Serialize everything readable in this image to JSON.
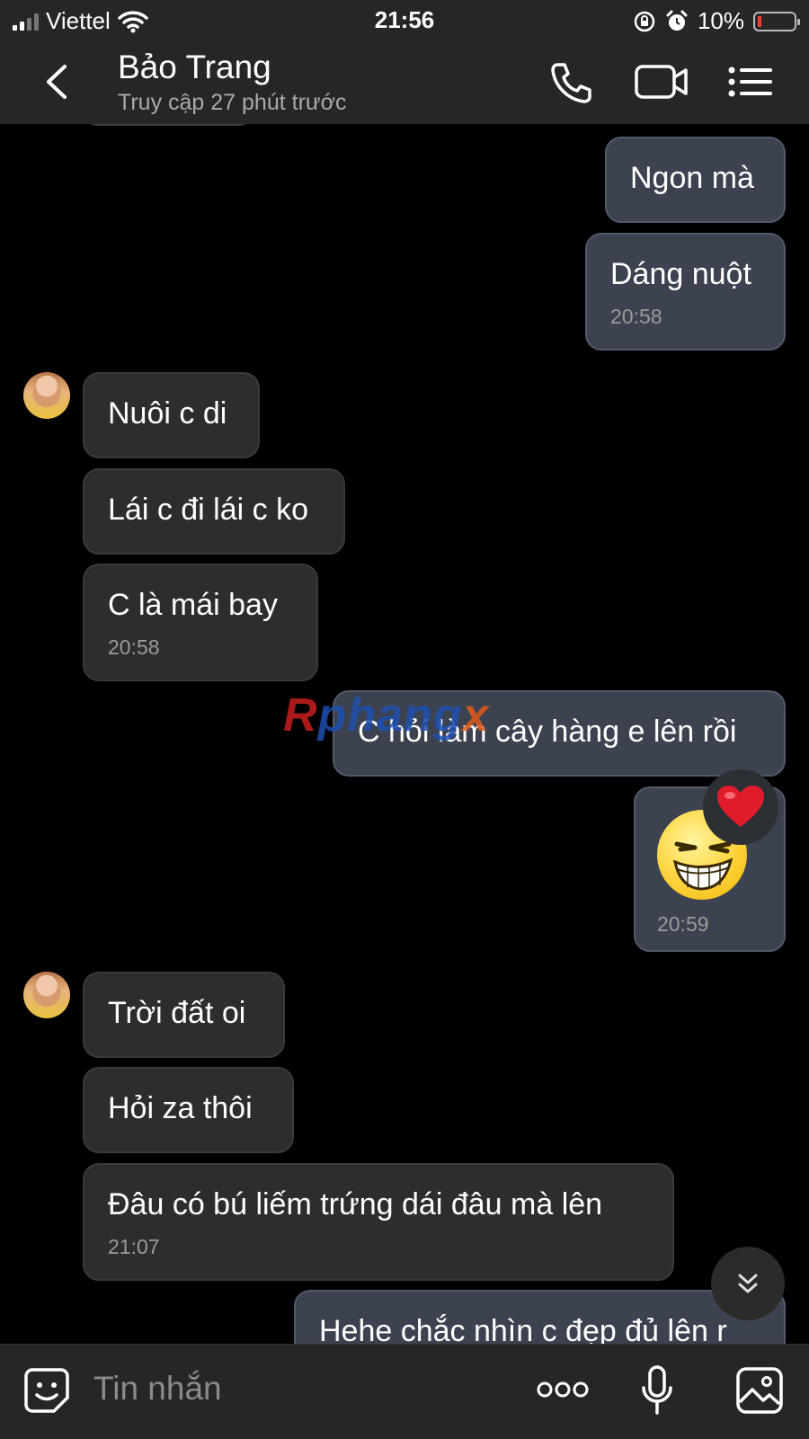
{
  "status_bar": {
    "carrier": "Viettel",
    "time": "21:56",
    "battery_percent": "10%"
  },
  "header": {
    "contact_name": "Bảo Trang",
    "last_seen": "Truy cập 27 phút trước"
  },
  "watermark": {
    "part1": "R",
    "part2": "phang",
    "part3": "x"
  },
  "messages": [
    {
      "text": "Ngon mà"
    },
    {
      "text": "Dáng nuột",
      "time": "20:58"
    },
    {
      "text": "Nuôi c di"
    },
    {
      "text": "Lái c đi lái c ko"
    },
    {
      "text": "C là mái bay",
      "time": "20:58"
    },
    {
      "text": "C hỏi làm cây hàng e lên rồi"
    },
    {
      "emoji": "smirk-grin-sticker",
      "reaction": "heart",
      "time": "20:59"
    },
    {
      "text": "Trời đất oi"
    },
    {
      "text": "Hỏi za thôi"
    },
    {
      "text": "Đâu có bú liếm trứng dái đâu mà lên",
      "time": "21:07"
    },
    {
      "text": "Hehe chắc nhìn c đẹp đủ lên r"
    }
  ],
  "composer": {
    "placeholder": "Tin nhắn"
  },
  "colors": {
    "outgoing_bubble": "#3c4250",
    "incoming_bubble": "#2d2d2d",
    "background": "#000000",
    "bar": "#262626",
    "battery_low": "#ff3b30",
    "heart": "#e21b2c"
  }
}
